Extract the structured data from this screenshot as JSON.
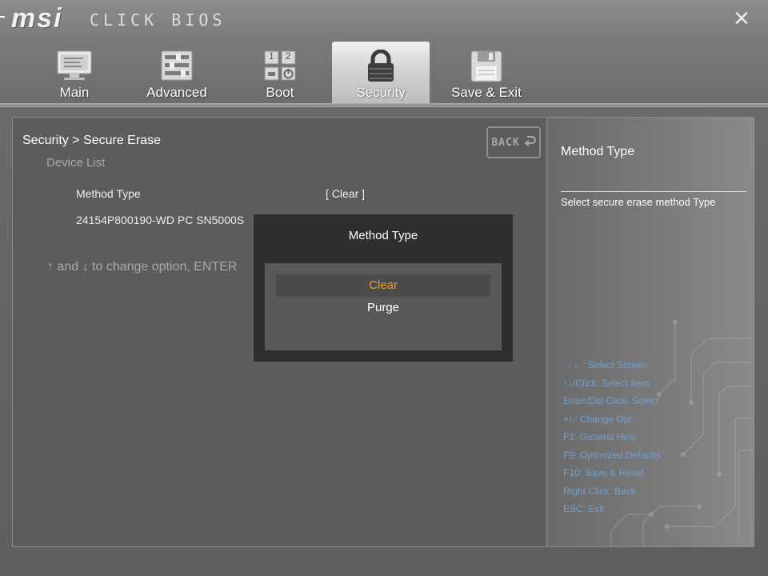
{
  "header": {
    "brand": "msi",
    "product": "CLICK BIOS",
    "tabs": [
      {
        "label": "Main",
        "icon": "monitor-icon"
      },
      {
        "label": "Advanced",
        "icon": "advanced-settings-icon"
      },
      {
        "label": "Boot",
        "icon": "boot-icon"
      },
      {
        "label": "Security",
        "icon": "padlock-icon",
        "active": true
      },
      {
        "label": "Save & Exit",
        "icon": "floppy-disk-icon"
      }
    ],
    "boot_icon_digits": [
      "1",
      "2"
    ]
  },
  "main": {
    "breadcrumb": "Security > Secure Erase",
    "subheading": "Device List",
    "rows": [
      {
        "label": "Method Type",
        "value": "[ Clear ]"
      },
      {
        "label": "24154P800190-WD PC SN5000S",
        "value": ""
      }
    ],
    "hint": "↑ and ↓ to change option, ENTER",
    "back_label": "BACK"
  },
  "modal": {
    "title": "Method Type",
    "options": [
      "Clear",
      "Purge"
    ],
    "selected": "Clear"
  },
  "help": {
    "title": "Method Type",
    "description": "Select secure erase method Type",
    "keys": [
      "→←: Select Screen",
      "↑↓/Click: Select Item",
      "Enter/Dbl Click: Select",
      "+/-: Change Opt.",
      "F1: General Help",
      "F9: Optimized Defaults",
      "F10: Save & Reset",
      "Right Click: Back",
      "ESC: Exit"
    ]
  },
  "colors": {
    "selected_option": "#e0a030",
    "key_help_text": "#6f9fd1",
    "modal_bg": "#2f2f2f"
  }
}
